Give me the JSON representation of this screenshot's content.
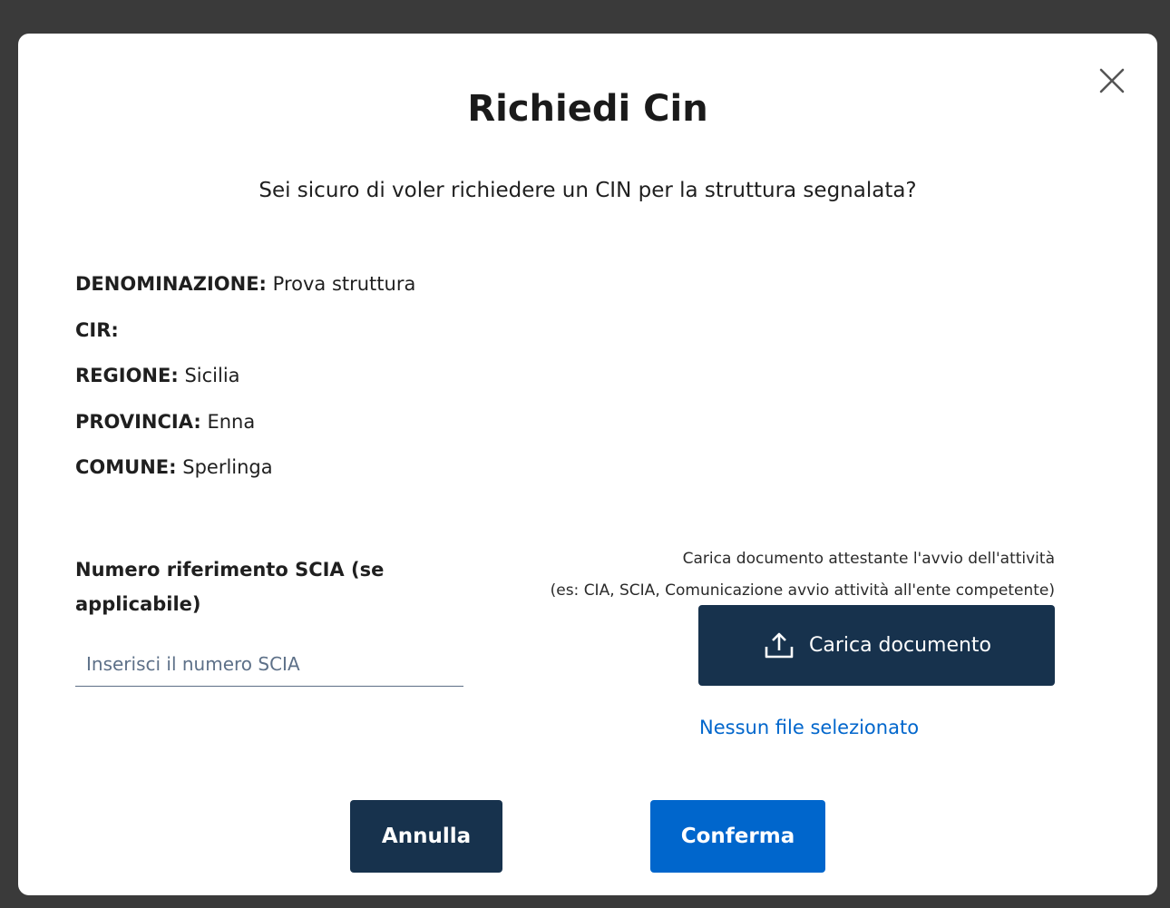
{
  "modal": {
    "title": "Richiedi Cin",
    "question": "Sei sicuro di voler richiedere un CIN per la struttura segnalata?",
    "close_icon": "close-icon",
    "details": [
      {
        "key": "DENOMINAZIONE:",
        "value": "Prova struttura"
      },
      {
        "key": "CIR:",
        "value": ""
      },
      {
        "key": "REGIONE:",
        "value": "Sicilia"
      },
      {
        "key": "PROVINCIA:",
        "value": "Enna"
      },
      {
        "key": "COMUNE:",
        "value": "Sperlinga"
      }
    ],
    "scia": {
      "label": "Numero riferimento SCIA (se applicabile)",
      "placeholder": "Inserisci il numero SCIA",
      "value": ""
    },
    "upload": {
      "note_line1": "Carica documento attestante l'avvio dell'attività",
      "note_line2": "(es: CIA, SCIA, Comunicazione avvio attività all'ente competente)",
      "button_label": "Carica documento",
      "icon": "upload-icon",
      "status": "Nessun file selezionato"
    },
    "actions": {
      "cancel_label": "Annulla",
      "confirm_label": "Conferma"
    }
  },
  "colors": {
    "primary_dark": "#17324d",
    "primary_blue": "#0066cc",
    "link_blue": "#0066cc",
    "backdrop": "#3a3a3a"
  }
}
